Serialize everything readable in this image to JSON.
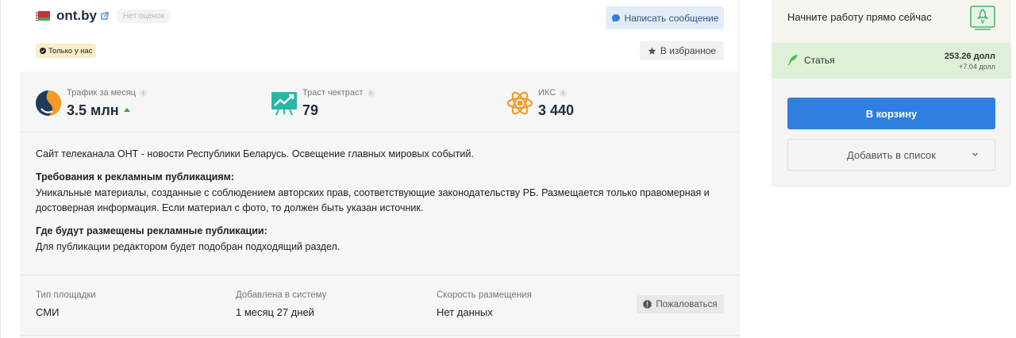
{
  "site": {
    "name": "ont.by",
    "rating_badge": "Нет оценок",
    "only_badge": "Только у нас"
  },
  "actions": {
    "message_button": "Написать сообщение",
    "favorite_button": "В избранное",
    "report_button": "Пожаловаться"
  },
  "metrics": [
    {
      "label": "Трафик за месяц",
      "value": "3.5 млн",
      "icon": "similarweb-icon",
      "trend": "up"
    },
    {
      "label": "Траст чектраст",
      "value": "79",
      "icon": "trust-chart-icon"
    },
    {
      "label": "ИКС",
      "value": "3 440",
      "icon": "atom-icon"
    }
  ],
  "description": {
    "intro": "Сайт телеканала ОНТ - новости Республики Беларусь. Освещение главных мировых событий.",
    "requirements_title": "Требования к рекламным публикациям:",
    "requirements_text": "Уникальные материалы, созданные с соблюдением авторских прав, соответствующие законодательству РБ. Размещается только правомерная и достоверная информация. Если материал с фото, то должен быть указан источник.",
    "placement_title": "Где будут размещены рекламные публикации:",
    "placement_text": "Для публикации редактором будет подобран подходящий раздел."
  },
  "details": [
    {
      "label": "Тип площадки",
      "value": "СМИ"
    },
    {
      "label": "Добавлена в систему",
      "value": "1 месяц 27 дней"
    },
    {
      "label": "Скорость размещения",
      "value": "Нет данных"
    }
  ],
  "sidebar": {
    "start_text": "Начните работу прямо сейчас",
    "article_label": "Статья",
    "article_price": "253.26 долл",
    "article_delta": "+7.04 долл",
    "cart_button": "В корзину",
    "add_list_button": "Добавить в список"
  },
  "colors": {
    "accent": "#2f7fe0",
    "trend_up": "#2ba94a",
    "article_bg": "#dff0d8",
    "badge_bg": "#fbedc9"
  }
}
